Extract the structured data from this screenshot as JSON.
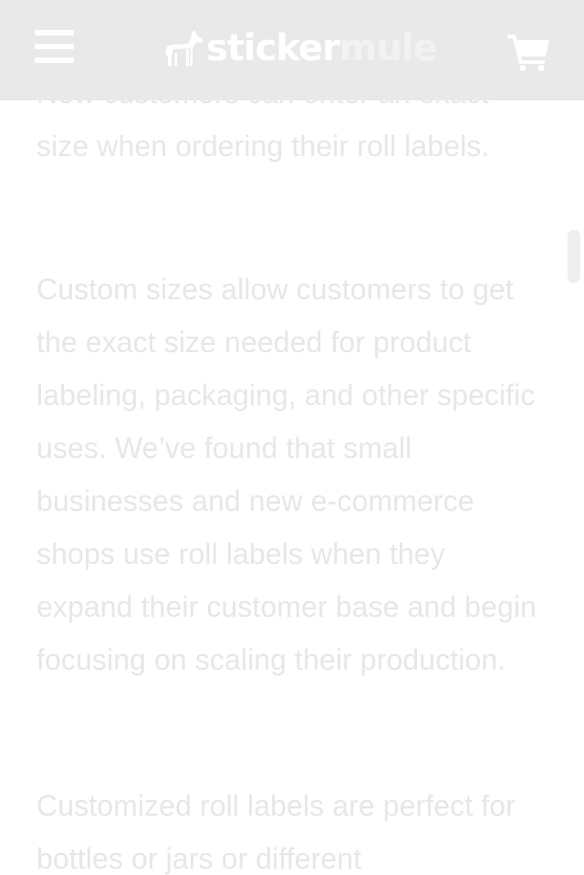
{
  "header": {
    "logo": {
      "part1": "sticker",
      "part2": "mule",
      "icon": "mule-icon"
    },
    "menu_icon": "hamburger-menu-icon",
    "cart_icon": "shopping-cart-icon",
    "background_color": "#e9e9e9"
  },
  "article": {
    "paragraphs": [
      "Now customers can enter an exact size when ordering their roll labels.",
      "Custom sizes allow customers to get the exact size needed for product labeling, packaging, and other specific uses. We’ve found that small businesses and new e-commerce shops use roll labels when they expand their customer base and begin focusing on scaling their production.",
      "Customized roll labels are perfect for bottles or jars or different"
    ],
    "text_color": "#e7e7e7"
  }
}
